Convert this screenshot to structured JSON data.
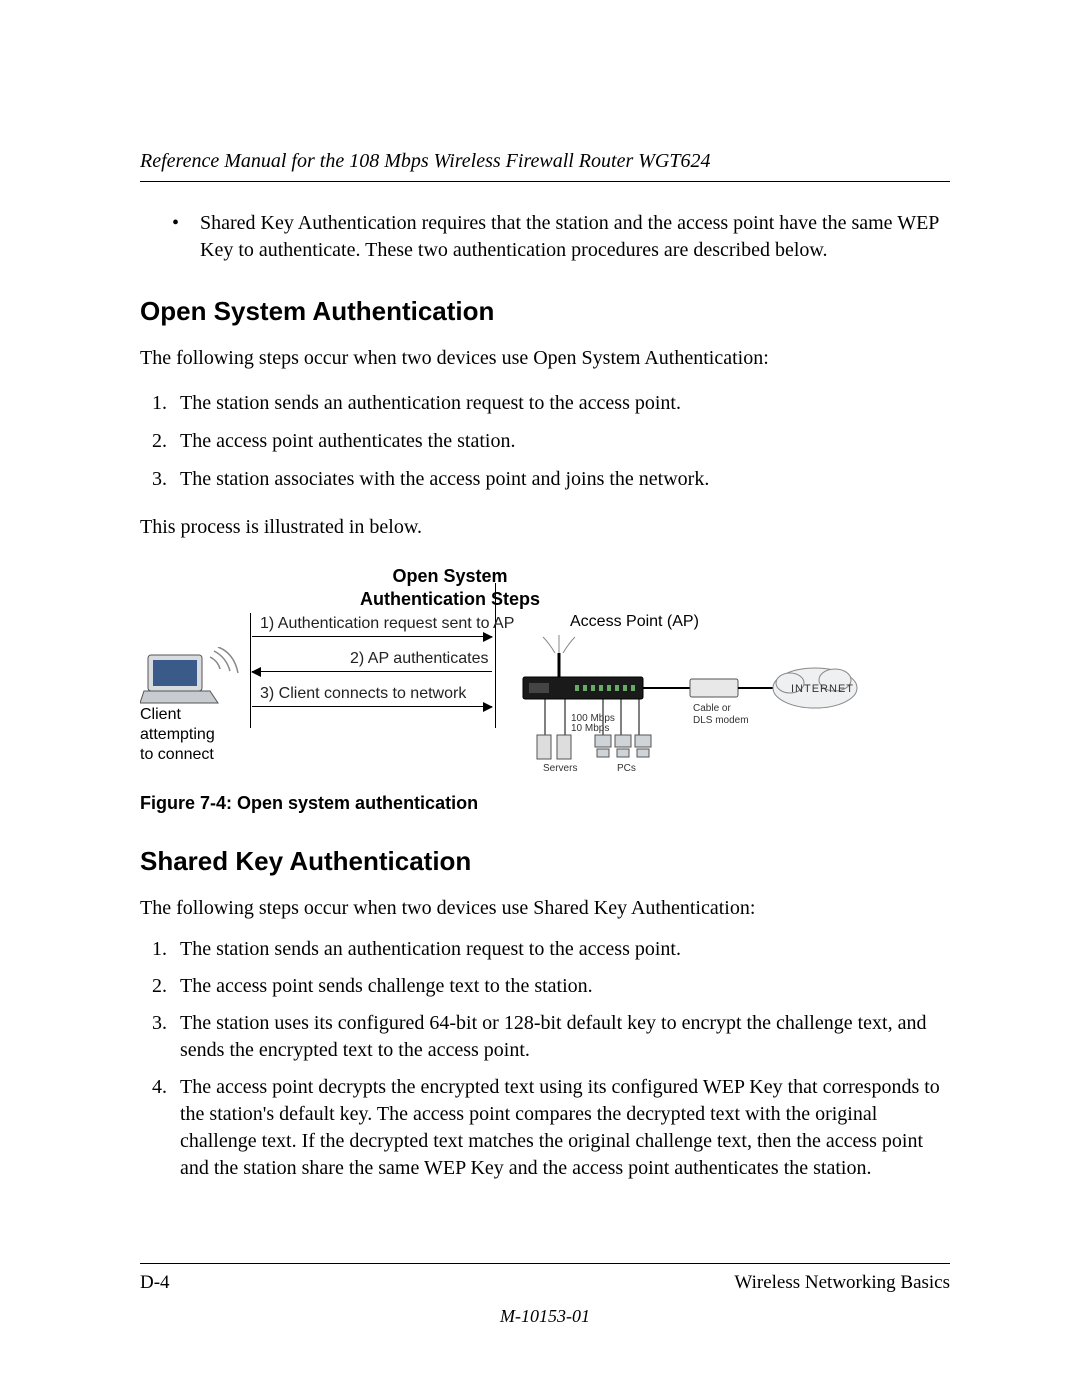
{
  "header": {
    "title": "Reference Manual for the 108 Mbps Wireless Firewall Router WGT624"
  },
  "intro_bullet": "Shared Key Authentication requires that the station and the access point have the same WEP Key to authenticate. These two authentication procedures are described below.",
  "section1": {
    "heading": "Open System Authentication",
    "intro": "The following steps occur when two devices use Open System Authentication:",
    "steps": [
      "The station sends an authentication request to the access point.",
      "The access point authenticates the station.",
      "The station associates with the access point and joins the network."
    ],
    "outro": "This process is illustrated in below."
  },
  "diagram": {
    "title_line1": "Open System",
    "title_line2": "Authentication Steps",
    "step1": "1) Authentication request sent to AP",
    "step2": "2) AP authenticates",
    "step3": "3) Client connects to network",
    "client_label_l1": "Client",
    "client_label_l2": "attempting",
    "client_label_l3": "to connect",
    "ap_label": "Access Point (AP)",
    "cable_label_l1": "Cable or",
    "cable_label_l2": "DLS modem",
    "internet_label": "INTERNET",
    "servers_label": "Servers",
    "pcs_label": "PCs",
    "speed_l1": "100 Mbps",
    "speed_l2": "10 Mbps"
  },
  "figure_caption": "Figure 7-4:  Open system authentication",
  "section2": {
    "heading": "Shared Key Authentication",
    "intro": "The following steps occur when two devices use Shared Key Authentication:",
    "steps": [
      "The station sends an authentication request to the access point.",
      "The access point sends challenge text to the station.",
      "The station uses its configured 64-bit or 128-bit default key to encrypt the challenge text, and sends the encrypted text to the access point.",
      "The access point decrypts the encrypted text using its configured WEP Key that corresponds to the station's default key. The access point compares the decrypted text with the original challenge text. If the decrypted text matches the original challenge text, then the access point and the station share the same WEP Key and the access point authenticates the station."
    ]
  },
  "footer": {
    "page_num": "D-4",
    "section_name": "Wireless Networking Basics",
    "doc_id": "M-10153-01"
  }
}
